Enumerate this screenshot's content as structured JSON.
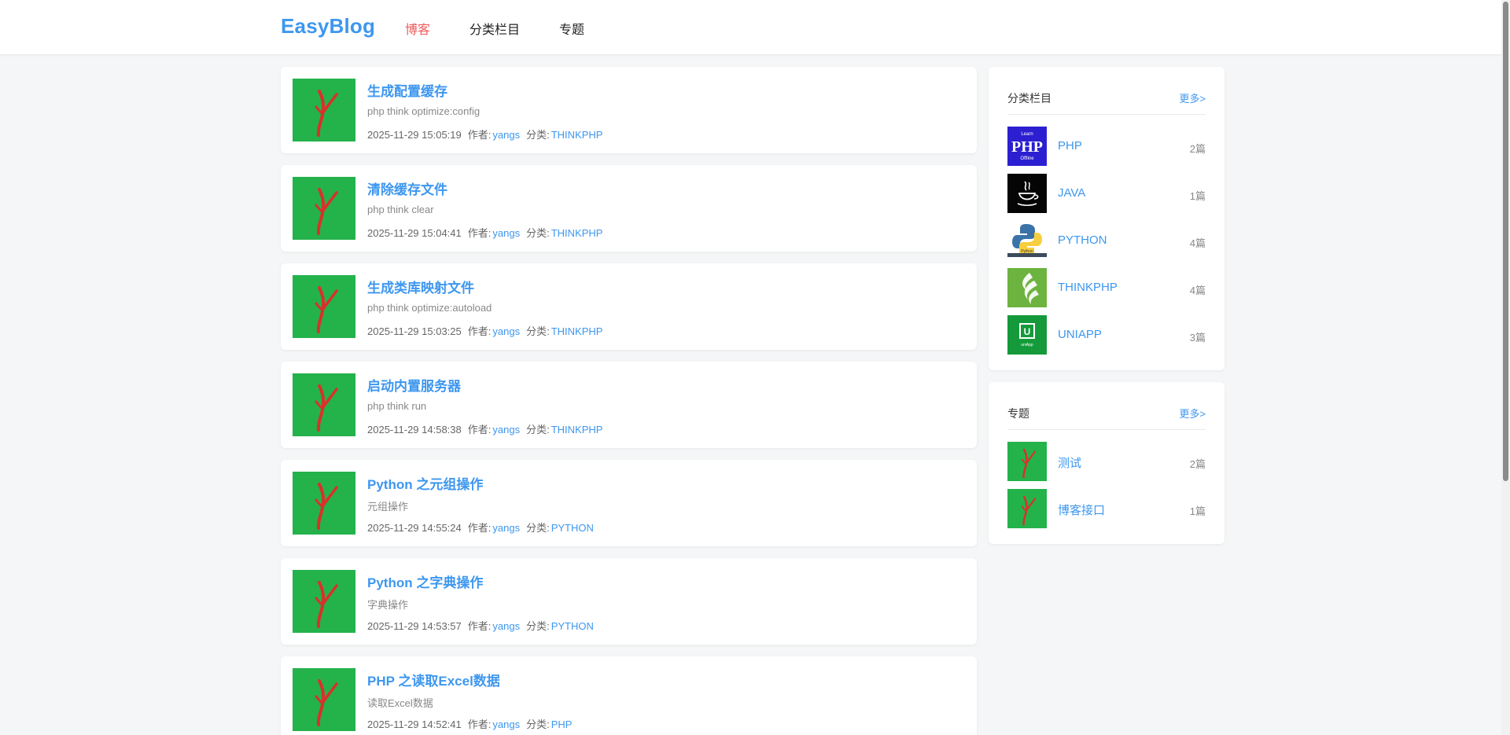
{
  "header": {
    "logo": "EasyBlog",
    "nav": [
      {
        "label": "博客",
        "active": true
      },
      {
        "label": "分类栏目",
        "active": false
      },
      {
        "label": "专题",
        "active": false
      }
    ]
  },
  "meta_labels": {
    "author": "作者:",
    "category": "分类:"
  },
  "articles": [
    {
      "title": "生成配置缓存",
      "desc": "php think optimize:config",
      "date": "2025-11-29 15:05:19",
      "author": "yangs",
      "category": "THINKPHP"
    },
    {
      "title": "清除缓存文件",
      "desc": "php think clear",
      "date": "2025-11-29 15:04:41",
      "author": "yangs",
      "category": "THINKPHP"
    },
    {
      "title": "生成类库映射文件",
      "desc": "php think optimize:autoload",
      "date": "2025-11-29 15:03:25",
      "author": "yangs",
      "category": "THINKPHP"
    },
    {
      "title": "启动内置服务器",
      "desc": "php think run",
      "date": "2025-11-29 14:58:38",
      "author": "yangs",
      "category": "THINKPHP"
    },
    {
      "title": "Python 之元组操作",
      "desc": "元组操作",
      "date": "2025-11-29 14:55:24",
      "author": "yangs",
      "category": "PYTHON"
    },
    {
      "title": "Python 之字典操作",
      "desc": "字典操作",
      "date": "2025-11-29 14:53:57",
      "author": "yangs",
      "category": "PYTHON"
    },
    {
      "title": "PHP 之读取Excel数据",
      "desc": "读取Excel数据",
      "date": "2025-11-29 14:52:41",
      "author": "yangs",
      "category": "PHP"
    }
  ],
  "sidebar": {
    "categories": {
      "title": "分类栏目",
      "more": "更多>",
      "items": [
        {
          "name": "PHP",
          "count": "2篇",
          "icon": "php-logo-icon",
          "icon_text_top": "Learn",
          "icon_text_main": "PHP",
          "icon_text_bottom": "Offline"
        },
        {
          "name": "JAVA",
          "count": "1篇",
          "icon": "java-logo-icon"
        },
        {
          "name": "PYTHON",
          "count": "4篇",
          "icon": "python-logo-icon",
          "icon_text_bottom": "Python"
        },
        {
          "name": "THINKPHP",
          "count": "4篇",
          "icon": "thinkphp-logo-icon"
        },
        {
          "name": "UNIAPP",
          "count": "3篇",
          "icon": "uniapp-logo-icon",
          "icon_text_main": "U",
          "icon_text_bottom": "uniApp"
        }
      ]
    },
    "topics": {
      "title": "专题",
      "more": "更多>",
      "items": [
        {
          "name": "测试",
          "count": "2篇",
          "icon": "topic-thumb-icon"
        },
        {
          "name": "博客接口",
          "count": "1篇",
          "icon": "topic-thumb-icon"
        }
      ]
    }
  },
  "colors": {
    "accent": "#3d97ef",
    "nav_active": "#f05a5a",
    "thumb_bg": "#24b24b",
    "thumb_mark": "#d8312a"
  }
}
